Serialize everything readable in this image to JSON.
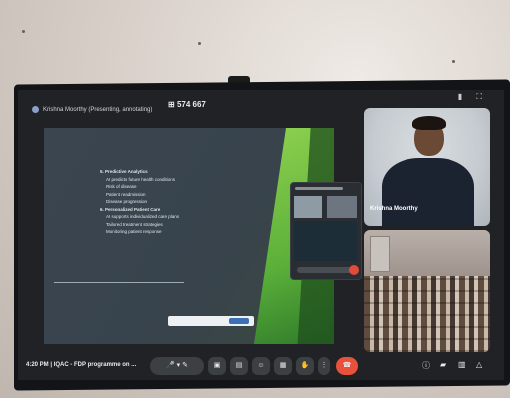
{
  "meeting": {
    "presenter_label": "Krishna Moorthy (Presenting, annotating)",
    "meeting_code": "574 667",
    "time_and_title": "4:20 PM  |  IQAC - FDP programme on ..."
  },
  "slide": {
    "items": [
      {
        "text": "5. Predictive Analytics",
        "style": "h"
      },
      {
        "text": "AI predicts future health conditions",
        "style": "sub"
      },
      {
        "text": "Risk of disease",
        "style": "sub"
      },
      {
        "text": "Patient readmission",
        "style": "sub"
      },
      {
        "text": "Disease progression",
        "style": "sub"
      },
      {
        "text": "6. Personalized Patient Care",
        "style": "h"
      },
      {
        "text": "AI supports individualized care plans",
        "style": "sub"
      },
      {
        "text": "Tailored treatment strategies",
        "style": "sub"
      },
      {
        "text": "Monitoring patient response",
        "style": "sub"
      }
    ]
  },
  "participants": {
    "speaker_name": "Krishna Moorthy"
  },
  "toolbar": {
    "buttons": [
      "mic-icon",
      "camera-icon",
      "pen-icon",
      "present-icon",
      "captions-icon",
      "emoji-icon",
      "layout-icon",
      "hand-icon",
      "more-icon",
      "end-call-icon"
    ],
    "right_icons": [
      "info-icon",
      "chat-icon",
      "people-icon",
      "activities-icon"
    ]
  },
  "colors": {
    "end_call": "#e8513a",
    "slide_green": "#8fd14f",
    "button_bg": "#3c4043"
  }
}
